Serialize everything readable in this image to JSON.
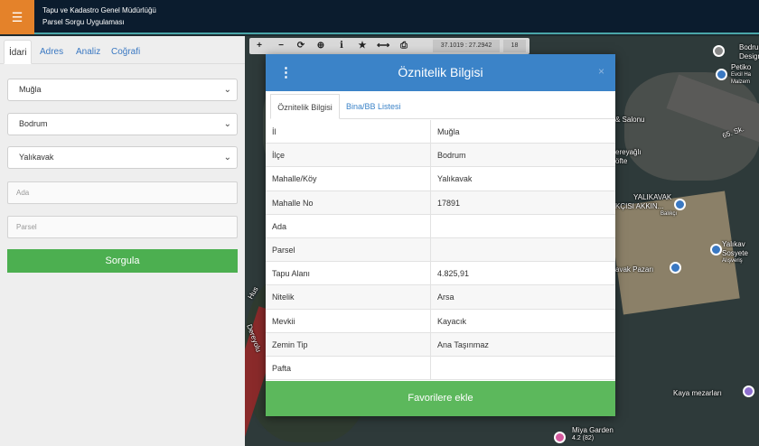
{
  "header": {
    "menu_icon": "hamburger-icon",
    "title_line1": "Tapu ve Kadastro Genel Müdürlüğü",
    "title_line2": "Parsel Sorgu Uygulaması"
  },
  "sidebar": {
    "tabs": [
      {
        "label": "İdari"
      },
      {
        "label": "Adres"
      },
      {
        "label": "Analiz"
      },
      {
        "label": "Coğrafi"
      }
    ],
    "il_select": "Muğla",
    "ilce_select": "Bodrum",
    "mahalle_select": "Yalıkavak",
    "ada_placeholder": "Ada",
    "parsel_placeholder": "Parsel",
    "query_button": "Sorgula"
  },
  "map": {
    "toolbar": {
      "coordinates": "37.1019 : 27.2942",
      "zoom_level": "18"
    },
    "labels": [
      "Bodrum",
      "Design",
      "Petiko",
      "Evcil Ha",
      "Malzem",
      "& Salonu",
      "65. Sk.",
      "ereyağlı",
      "öfte",
      "YALIKAVAK",
      "KÇISI AKKIN...",
      "Balıkçı",
      "Yalıkav",
      "Sosyete",
      "Alışveriş",
      "avak Pazarı",
      "Kaya mezarları",
      "Miya Garden",
      "4.2 (82)",
      "Hus",
      "Dereyolu"
    ]
  },
  "modal": {
    "title": "Öznitelik Bilgisi",
    "close": "×",
    "tabs": [
      "Öznitelik Bilgisi",
      "Bina/BB Listesi"
    ],
    "rows": [
      {
        "key": "İl",
        "value": "Muğla"
      },
      {
        "key": "İlçe",
        "value": "Bodrum"
      },
      {
        "key": "Mahalle/Köy",
        "value": "Yalıkavak"
      },
      {
        "key": "Mahalle No",
        "value": "17891"
      },
      {
        "key": "Ada",
        "value": ""
      },
      {
        "key": "Parsel",
        "value": ""
      },
      {
        "key": "Tapu Alanı",
        "value": "4.825,91"
      },
      {
        "key": "Nitelik",
        "value": "Arsa"
      },
      {
        "key": "Mevkii",
        "value": "Kayacık"
      },
      {
        "key": "Zemin Tip",
        "value": "Ana Taşınmaz"
      },
      {
        "key": "Pafta",
        "value": ""
      }
    ],
    "favorite_button": "Favorilere ekle"
  },
  "colors": {
    "header_bg": "#0b1c2e",
    "menu_accent": "#e4822a",
    "modal_header": "#3b83c8",
    "action_green": "#4caf50"
  }
}
